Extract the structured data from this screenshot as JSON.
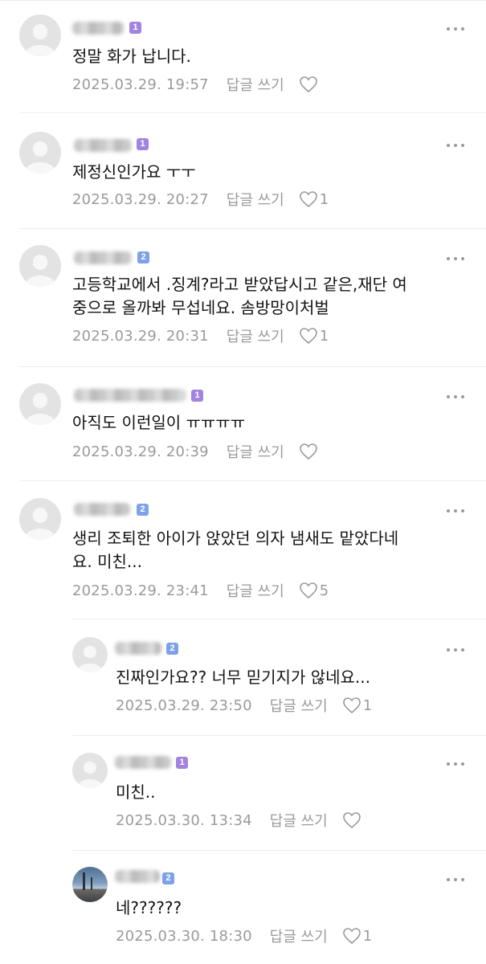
{
  "comments": [
    {
      "text": "정말 화가 납니다.",
      "time": "2025.03.29. 19:57",
      "reply": "답글 쓰기",
      "likes": "",
      "level": "1"
    },
    {
      "text": "제정신인가요 ㅜㅜ",
      "time": "2025.03.29. 20:27",
      "reply": "답글 쓰기",
      "likes": "1",
      "level": "1"
    },
    {
      "text": "고등학교에서 .징계?라고 받았답시고 같은,재단 여\n중으로 올까봐 무섭네요. 솜방망이처벌",
      "time": "2025.03.29. 20:31",
      "reply": "답글 쓰기",
      "likes": "1",
      "level": "2"
    },
    {
      "text": "아직도 이런일이 ㅠㅠㅠㅠ",
      "time": "2025.03.29. 20:39",
      "reply": "답글 쓰기",
      "likes": "",
      "level": "1"
    },
    {
      "text": "생리 조퇴한 아이가 앉았던 의자 냄새도 맡았다네\n요. 미친...",
      "time": "2025.03.29. 23:41",
      "reply": "답글 쓰기",
      "likes": "5",
      "level": "2"
    }
  ],
  "replies": [
    {
      "text": "진짜인가요?? 너무 믿기지가 않네요...",
      "time": "2025.03.29. 23:50",
      "reply": "답글 쓰기",
      "likes": "1",
      "level": "2"
    },
    {
      "text": "미친..",
      "time": "2025.03.30. 13:34",
      "reply": "답글 쓰기",
      "likes": "",
      "level": "1"
    },
    {
      "text": "네??????",
      "time": "2025.03.30. 18:30",
      "reply": "답글 쓰기",
      "likes": "1",
      "level": "2"
    }
  ],
  "icons": {
    "avatar": "default-profile-icon",
    "more": "more-options-icon",
    "like": "heart-outline-icon"
  },
  "colors": {
    "badge_level1": "#a383e0",
    "badge_level2": "#7ea2e6",
    "meta_gray": "#9a9a9a"
  }
}
